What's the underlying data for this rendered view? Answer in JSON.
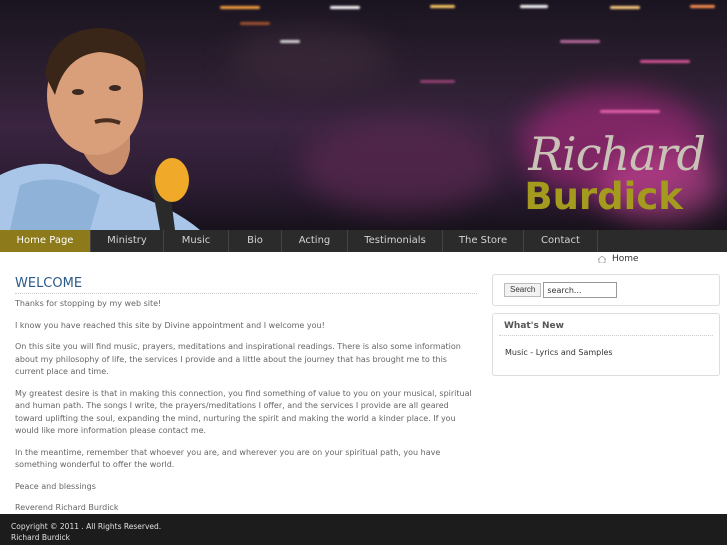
{
  "header": {
    "brand_first": "Richard",
    "brand_last": "Burdick"
  },
  "nav": {
    "items": [
      {
        "label": "Home Page",
        "active": true
      },
      {
        "label": "Ministry",
        "active": false
      },
      {
        "label": "Music",
        "active": false
      },
      {
        "label": "Bio",
        "active": false
      },
      {
        "label": "Acting",
        "active": false
      },
      {
        "label": "Testimonials",
        "active": false
      },
      {
        "label": "The Store",
        "active": false
      },
      {
        "label": "Contact",
        "active": false
      }
    ]
  },
  "breadcrumb": {
    "label": "Home"
  },
  "main": {
    "title": "WELCOME",
    "paragraphs": [
      "Thanks for stopping by my web site!",
      "I know you have reached this site by Divine appointment and I welcome you!",
      "On this site you will find music, prayers, meditations and inspirational readings. There is also some information about my philosophy of life, the services I provide and a little about the journey that has brought me to this current place and time.",
      "My greatest desire is that in making this connection, you find something of value to you on your musical, spiritual and human path. The songs I write, the prayers/meditations I offer, and the services I provide are all geared toward uplifting the soul, expanding the mind, nurturing the spirit and making the world a kinder place.  If you would like more information please contact me.",
      "In the meantime, remember that whoever you are, and wherever you are on your spiritual path, you have something wonderful to offer the world.",
      "Peace and blessings",
      "Reverend Richard Burdick"
    ]
  },
  "sidebar": {
    "search_button": "Search",
    "search_value": "search...",
    "whats_new_title": "What's New",
    "whats_new_item": "Music - Lyrics and Samples"
  },
  "footer": {
    "line1": "Copyright © 2011 . All Rights Reserved.",
    "line2": "Richard Burdick"
  },
  "colors": {
    "nav_active": "#8c7a1b",
    "title_blue": "#2b5a8a",
    "brand_gold": "#a39a1e"
  }
}
